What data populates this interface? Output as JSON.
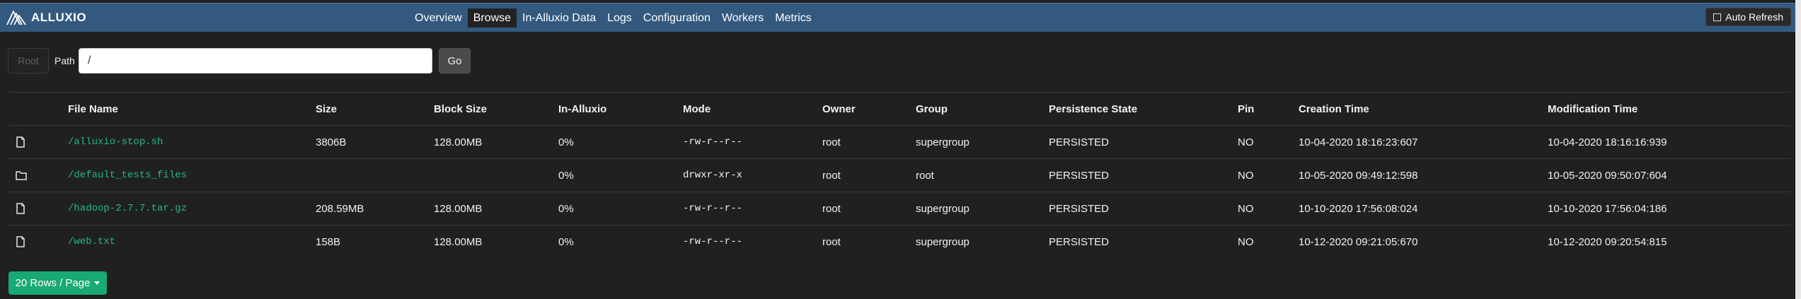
{
  "brand": {
    "name": "ALLUXIO",
    "icon": "alluxio-logo-icon"
  },
  "nav": {
    "items": [
      {
        "label": "Overview",
        "active": false
      },
      {
        "label": "Browse",
        "active": true
      },
      {
        "label": "In-Alluxio Data",
        "active": false
      },
      {
        "label": "Logs",
        "active": false
      },
      {
        "label": "Configuration",
        "active": false
      },
      {
        "label": "Workers",
        "active": false
      },
      {
        "label": "Metrics",
        "active": false
      }
    ],
    "auto_refresh_label": "Auto Refresh",
    "auto_refresh_checked": false
  },
  "path_bar": {
    "root_label": "Root",
    "path_label": "Path",
    "path_value": "/",
    "go_label": "Go"
  },
  "table": {
    "columns": [
      "File Name",
      "Size",
      "Block Size",
      "In-Alluxio",
      "Mode",
      "Owner",
      "Group",
      "Persistence State",
      "Pin",
      "Creation Time",
      "Modification Time"
    ],
    "rows": [
      {
        "icon": "file-icon",
        "name": "/alluxio-stop.sh",
        "size": "3806B",
        "block_size": "128.00MB",
        "in_alluxio": "0%",
        "mode": "-rw-r--r--",
        "owner": "root",
        "group": "supergroup",
        "persistence": "PERSISTED",
        "pin": "NO",
        "created": "10-04-2020 18:16:23:607",
        "modified": "10-04-2020 18:16:16:939"
      },
      {
        "icon": "folder-icon",
        "name": "/default_tests_files",
        "size": "",
        "block_size": "",
        "in_alluxio": "0%",
        "mode": "drwxr-xr-x",
        "owner": "root",
        "group": "root",
        "persistence": "PERSISTED",
        "pin": "NO",
        "created": "10-05-2020 09:49:12:598",
        "modified": "10-05-2020 09:50:07:604"
      },
      {
        "icon": "file-icon",
        "name": "/hadoop-2.7.7.tar.gz",
        "size": "208.59MB",
        "block_size": "128.00MB",
        "in_alluxio": "0%",
        "mode": "-rw-r--r--",
        "owner": "root",
        "group": "supergroup",
        "persistence": "PERSISTED",
        "pin": "NO",
        "created": "10-10-2020 17:56:08:024",
        "modified": "10-10-2020 17:56:04:186"
      },
      {
        "icon": "file-icon",
        "name": "/web.txt",
        "size": "158B",
        "block_size": "128.00MB",
        "in_alluxio": "0%",
        "mode": "-rw-r--r--",
        "owner": "root",
        "group": "supergroup",
        "persistence": "PERSISTED",
        "pin": "NO",
        "created": "10-12-2020 09:21:05:670",
        "modified": "10-12-2020 09:20:54:815"
      }
    ]
  },
  "pagination": {
    "rows_per_page_label": "20 Rows / Page"
  },
  "colors": {
    "navbar": "#33597f",
    "background": "#202020",
    "link": "#25b883",
    "accent_button": "#19a974"
  }
}
